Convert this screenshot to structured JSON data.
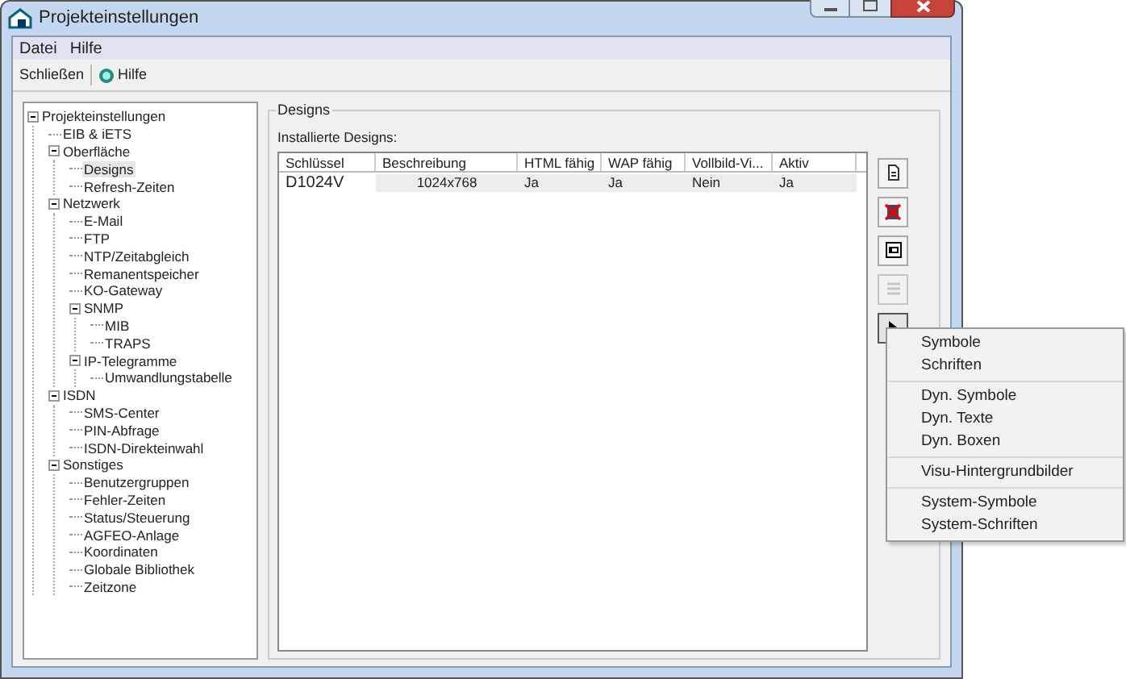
{
  "window": {
    "title": "Projekteinstellungen"
  },
  "menu_bar": [
    "Datei",
    "Hilfe"
  ],
  "toolbar": [
    {
      "label": "Schließen",
      "kind": "text"
    },
    {
      "label": "Hilfe",
      "kind": "help"
    }
  ],
  "tree": [
    {
      "label": "Projekteinstellungen",
      "selected": false,
      "expanded": true,
      "children": [
        {
          "label": "EIB & iETS",
          "selected": false
        },
        {
          "label": "Oberfläche",
          "selected": false,
          "expanded": true,
          "children": [
            {
              "label": "Designs",
              "selected": true
            },
            {
              "label": "Refresh-Zeiten",
              "selected": false
            }
          ]
        },
        {
          "label": "Netzwerk",
          "selected": false,
          "expanded": true,
          "children": [
            {
              "label": "E-Mail",
              "selected": false
            },
            {
              "label": "FTP",
              "selected": false
            },
            {
              "label": "NTP/Zeitabgleich",
              "selected": false
            },
            {
              "label": "Remanentspeicher",
              "selected": false
            },
            {
              "label": "KO-Gateway",
              "selected": false
            },
            {
              "label": "SNMP",
              "selected": false,
              "expanded": true,
              "children": [
                {
                  "label": "MIB",
                  "selected": false
                },
                {
                  "label": "TRAPS",
                  "selected": false
                }
              ]
            },
            {
              "label": "IP-Telegramme",
              "selected": false,
              "expanded": true,
              "children": [
                {
                  "label": "Umwandlungstabelle",
                  "selected": false
                }
              ]
            }
          ]
        },
        {
          "label": "ISDN",
          "selected": false,
          "expanded": true,
          "children": [
            {
              "label": "SMS-Center",
              "selected": false
            },
            {
              "label": "PIN-Abfrage",
              "selected": false
            },
            {
              "label": "ISDN-Direkteinwahl",
              "selected": false
            }
          ]
        },
        {
          "label": "Sonstiges",
          "selected": false,
          "expanded": true,
          "children": [
            {
              "label": "Benutzergruppen",
              "selected": false
            },
            {
              "label": "Fehler-Zeiten",
              "selected": false
            },
            {
              "label": "Status/Steuerung",
              "selected": false
            },
            {
              "label": "AGFEO-Anlage",
              "selected": false
            },
            {
              "label": "Koordinaten",
              "selected": false
            },
            {
              "label": "Globale Bibliothek",
              "selected": false
            },
            {
              "label": "Zeitzone",
              "selected": false
            }
          ]
        }
      ]
    }
  ],
  "group": {
    "title": "Designs",
    "list_label": "Installierte Designs:"
  },
  "table": {
    "columns": [
      "Schlüssel",
      "Beschreibung",
      "HTML fähig",
      "WAP fähig",
      "Vollbild-Vi...",
      "Aktiv"
    ],
    "rows": [
      {
        "cells": [
          "D1024V",
          "1024x768",
          "Ja",
          "Ja",
          "Nein",
          "Ja"
        ],
        "selected": true
      }
    ]
  },
  "side_buttons": [
    {
      "kind": "new",
      "disabled": false,
      "pressed": false
    },
    {
      "kind": "delete",
      "disabled": false,
      "pressed": false
    },
    {
      "kind": "edit",
      "disabled": false,
      "pressed": false
    },
    {
      "kind": "list",
      "disabled": true,
      "pressed": false
    },
    {
      "kind": "more",
      "disabled": false,
      "pressed": true
    }
  ],
  "popup_menu": [
    [
      "Symbole",
      "Schriften"
    ],
    [
      "Dyn. Symbole",
      "Dyn. Texte",
      "Dyn. Boxen"
    ],
    [
      "Visu-Hintergrundbilder"
    ],
    [
      "System-Symbole",
      "System-Schriften"
    ]
  ]
}
